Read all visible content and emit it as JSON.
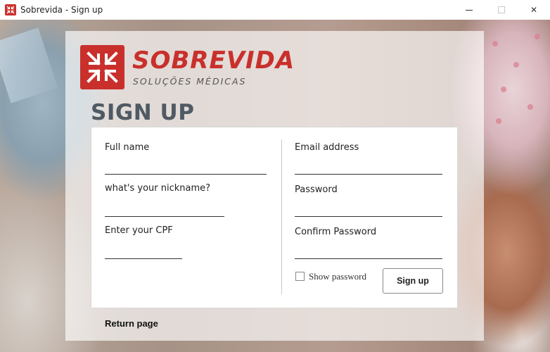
{
  "window": {
    "title": "Sobrevida - Sign up",
    "minimize_icon": "minimize-icon",
    "maximize_icon": "maximize-icon",
    "close_icon": "close-icon",
    "close_glyph": "✕"
  },
  "brand": {
    "name": "SOBREVIDA",
    "tagline": "SOLUÇÕES MÉDICAS",
    "color": "#c9302c",
    "logo_icon": "sobrevida-logo-icon"
  },
  "page": {
    "heading": "SIGN UP"
  },
  "form": {
    "full_name": {
      "label": "Full name",
      "value": ""
    },
    "nickname": {
      "label": "what's your nickname?",
      "value": ""
    },
    "cpf": {
      "label": "Enter your CPF",
      "value": ""
    },
    "email": {
      "label": "Email address",
      "value": ""
    },
    "password": {
      "label": "Password",
      "value": ""
    },
    "confirm_password": {
      "label": "Confirm Password",
      "value": ""
    },
    "show_password": {
      "label": "Show password",
      "checked": false
    },
    "submit_label": "Sign up"
  },
  "footer": {
    "return_label": "Return page"
  }
}
